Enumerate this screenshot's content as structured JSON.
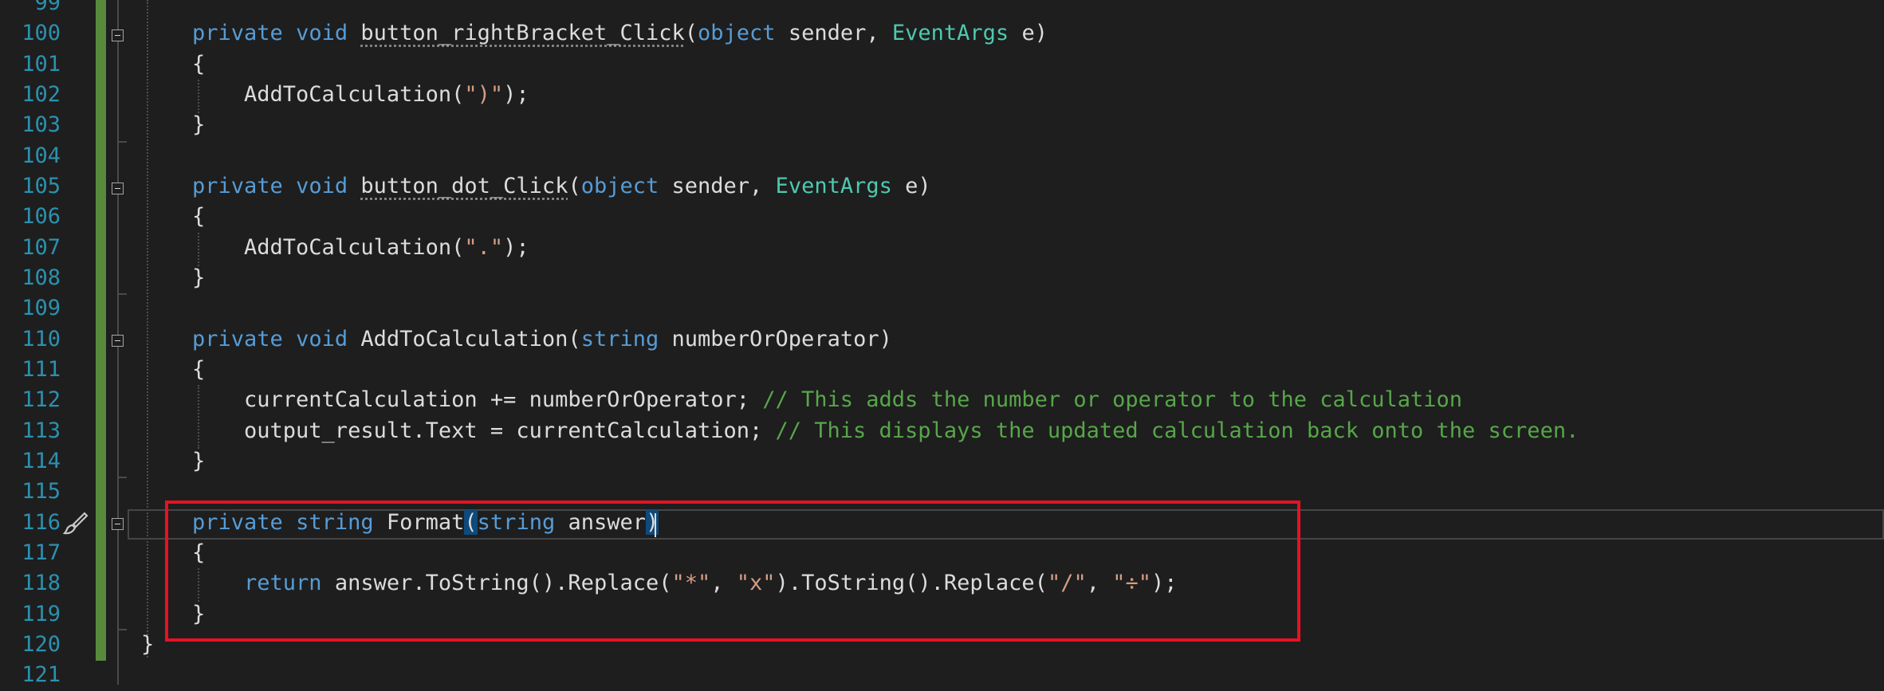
{
  "colors": {
    "background": "#1e1e1e",
    "line_number": "#2b91af",
    "keyword": "#569cd6",
    "type": "#4ec9b0",
    "string": "#d69d85",
    "comment": "#57a64a",
    "text": "#dcdcdc",
    "change_bar": "#578a3c",
    "highlight_box": "#e81123"
  },
  "icons": {
    "quick_action": "paintbrush-icon",
    "collapse": "collapse-minus-icon"
  },
  "lines": [
    {
      "number": "99",
      "tokens": []
    },
    {
      "number": "100",
      "tokens": [
        {
          "t": "private",
          "c": "kw"
        },
        {
          "t": " ",
          "c": "tx"
        },
        {
          "t": "void",
          "c": "kw"
        },
        {
          "t": " ",
          "c": "tx"
        },
        {
          "t": "button_rightBracket_Click",
          "c": "tx",
          "squiggle": true
        },
        {
          "t": "(",
          "c": "tx"
        },
        {
          "t": "object",
          "c": "kw"
        },
        {
          "t": " sender, ",
          "c": "tx"
        },
        {
          "t": "EventArgs",
          "c": "ty"
        },
        {
          "t": " e)",
          "c": "tx"
        }
      ]
    },
    {
      "number": "101",
      "tokens": [
        {
          "t": "{",
          "c": "tx"
        }
      ]
    },
    {
      "number": "102",
      "tokens": [
        {
          "t": "    AddToCalculation(",
          "c": "tx"
        },
        {
          "t": "\")\"",
          "c": "st"
        },
        {
          "t": ");",
          "c": "tx"
        }
      ]
    },
    {
      "number": "103",
      "tokens": [
        {
          "t": "}",
          "c": "tx"
        }
      ]
    },
    {
      "number": "104",
      "tokens": []
    },
    {
      "number": "105",
      "tokens": [
        {
          "t": "private",
          "c": "kw"
        },
        {
          "t": " ",
          "c": "tx"
        },
        {
          "t": "void",
          "c": "kw"
        },
        {
          "t": " ",
          "c": "tx"
        },
        {
          "t": "button_dot_Click",
          "c": "tx",
          "squiggle": true
        },
        {
          "t": "(",
          "c": "tx"
        },
        {
          "t": "object",
          "c": "kw"
        },
        {
          "t": " sender, ",
          "c": "tx"
        },
        {
          "t": "EventArgs",
          "c": "ty"
        },
        {
          "t": " e)",
          "c": "tx"
        }
      ]
    },
    {
      "number": "106",
      "tokens": [
        {
          "t": "{",
          "c": "tx"
        }
      ]
    },
    {
      "number": "107",
      "tokens": [
        {
          "t": "    AddToCalculation(",
          "c": "tx"
        },
        {
          "t": "\".\"",
          "c": "st"
        },
        {
          "t": ");",
          "c": "tx"
        }
      ]
    },
    {
      "number": "108",
      "tokens": [
        {
          "t": "}",
          "c": "tx"
        }
      ]
    },
    {
      "number": "109",
      "tokens": []
    },
    {
      "number": "110",
      "tokens": [
        {
          "t": "private",
          "c": "kw"
        },
        {
          "t": " ",
          "c": "tx"
        },
        {
          "t": "void",
          "c": "kw"
        },
        {
          "t": " AddToCalculation(",
          "c": "tx"
        },
        {
          "t": "string",
          "c": "kw"
        },
        {
          "t": " numberOrOperator)",
          "c": "tx"
        }
      ]
    },
    {
      "number": "111",
      "tokens": [
        {
          "t": "{",
          "c": "tx"
        }
      ]
    },
    {
      "number": "112",
      "tokens": [
        {
          "t": "    currentCalculation += numberOrOperator; ",
          "c": "tx"
        },
        {
          "t": "// This adds the number or operator to the calculation",
          "c": "cm"
        }
      ]
    },
    {
      "number": "113",
      "tokens": [
        {
          "t": "    output_result.Text = currentCalculation; ",
          "c": "tx"
        },
        {
          "t": "// This displays the updated calculation back onto the screen.",
          "c": "cm"
        }
      ]
    },
    {
      "number": "114",
      "tokens": [
        {
          "t": "}",
          "c": "tx"
        }
      ]
    },
    {
      "number": "115",
      "tokens": []
    },
    {
      "number": "116",
      "tokens": [
        {
          "t": "private",
          "c": "kw"
        },
        {
          "t": " ",
          "c": "tx"
        },
        {
          "t": "string",
          "c": "kw"
        },
        {
          "t": " Format",
          "c": "tx"
        },
        {
          "t": "(",
          "c": "tx",
          "hl": true
        },
        {
          "t": "string",
          "c": "kw"
        },
        {
          "t": " answer",
          "c": "tx"
        },
        {
          "t": ")",
          "c": "tx",
          "hl": true
        }
      ]
    },
    {
      "number": "117",
      "tokens": [
        {
          "t": "{",
          "c": "tx"
        }
      ]
    },
    {
      "number": "118",
      "tokens": [
        {
          "t": "    ",
          "c": "tx"
        },
        {
          "t": "return",
          "c": "kw"
        },
        {
          "t": " answer.ToString().Replace(",
          "c": "tx"
        },
        {
          "t": "\"*\"",
          "c": "st"
        },
        {
          "t": ", ",
          "c": "tx"
        },
        {
          "t": "\"x\"",
          "c": "st"
        },
        {
          "t": ").ToString().Replace(",
          "c": "tx"
        },
        {
          "t": "\"/\"",
          "c": "st"
        },
        {
          "t": ", ",
          "c": "tx"
        },
        {
          "t": "\"÷\"",
          "c": "st"
        },
        {
          "t": ");",
          "c": "tx"
        }
      ]
    },
    {
      "number": "119",
      "tokens": [
        {
          "t": "}",
          "c": "tx"
        }
      ]
    },
    {
      "number": "120",
      "tokens": [
        {
          "t": "}",
          "c": "tx"
        }
      ]
    },
    {
      "number": "121",
      "tokens": []
    }
  ]
}
